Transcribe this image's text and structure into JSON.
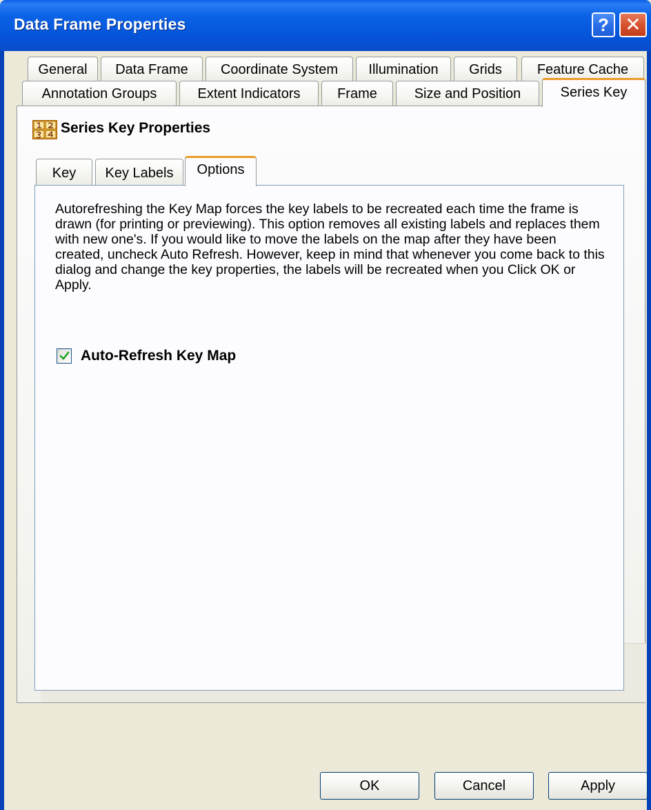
{
  "window": {
    "title": "Data Frame Properties",
    "help_label": "?",
    "close_label": "✕"
  },
  "tabs": {
    "row1": [
      "General",
      "Data Frame",
      "Coordinate System",
      "Illumination",
      "Grids",
      "Feature Cache"
    ],
    "row2": [
      "Annotation Groups",
      "Extent Indicators",
      "Frame",
      "Size and Position",
      "Series Key"
    ],
    "active": "Series Key"
  },
  "section": {
    "icon": "series-key-icon",
    "title": "Series Key Properties"
  },
  "subtabs": {
    "items": [
      "Key",
      "Key Labels",
      "Options"
    ],
    "active": "Options"
  },
  "options": {
    "description": "Autorefreshing the Key Map forces the key labels to be recreated each time the frame is drawn (for printing or previewing).  This option removes all existing labels and replaces them with new one's.  If you would like to move the labels on the map after they have been created, uncheck Auto Refresh.  However, keep in mind that whenever you come back to this dialog and change the key properties, the labels will be recreated when you Click OK or Apply.",
    "auto_refresh_label": "Auto-Refresh Key Map",
    "auto_refresh_checked": true
  },
  "buttons": {
    "ok": "OK",
    "cancel": "Cancel",
    "apply": "Apply"
  },
  "colors": {
    "title_bar": "#0554d9",
    "active_tab_accent": "#e89b27",
    "close_button": "#d7532f"
  }
}
